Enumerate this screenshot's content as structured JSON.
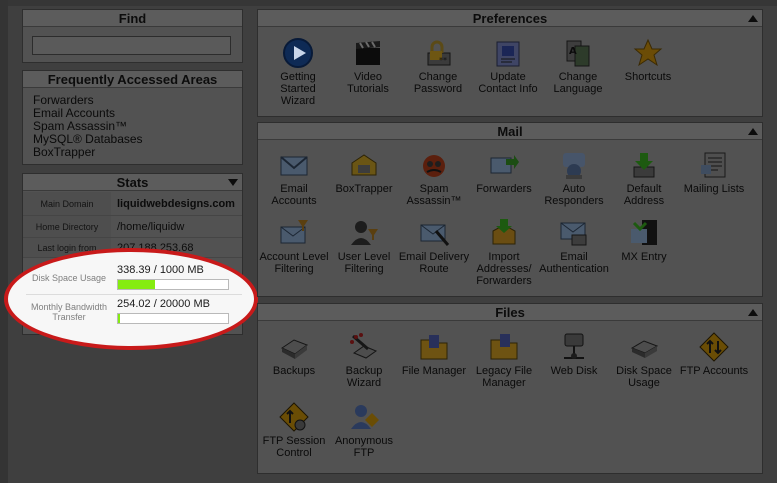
{
  "find": {
    "title": "Find",
    "input_value": ""
  },
  "faa": {
    "title": "Frequently Accessed Areas",
    "links": [
      "Forwarders",
      "Email Accounts",
      "Spam Assassin™",
      "MySQL® Databases",
      "BoxTrapper"
    ]
  },
  "stats": {
    "title": "Stats",
    "rows": [
      {
        "label": "Main Domain",
        "value": "liquidwebdesigns.com"
      },
      {
        "label": "Home Directory",
        "value": "/home/liquidw"
      },
      {
        "label": "Last login from",
        "value": "207.188.253.68"
      }
    ],
    "disk": {
      "label": "Disk Space Usage",
      "value": "338.39 / 1000 MB",
      "fraction": 0.34
    },
    "bandwidth": {
      "label": "Monthly Bandwidth Transfer",
      "value": "254.02 / 20000 MB",
      "fraction": 0.02
    }
  },
  "preferences": {
    "title": "Preferences",
    "items": [
      {
        "icon": "play-icon",
        "label": "Getting Started Wizard"
      },
      {
        "icon": "clapperboard-icon",
        "label": "Video Tutorials"
      },
      {
        "icon": "lock-password-icon",
        "label": "Change Password"
      },
      {
        "icon": "contact-card-icon",
        "label": "Update Contact Info"
      },
      {
        "icon": "language-icon",
        "label": "Change Language"
      },
      {
        "icon": "star-icon",
        "label": "Shortcuts"
      }
    ]
  },
  "mail": {
    "title": "Mail",
    "items": [
      {
        "icon": "envelope-icon",
        "label": "Email Accounts"
      },
      {
        "icon": "boxtrapper-icon",
        "label": "BoxTrapper"
      },
      {
        "icon": "spam-assassin-icon",
        "label": "Spam Assassin™"
      },
      {
        "icon": "forward-arrow-icon",
        "label": "Forwarders"
      },
      {
        "icon": "auto-responder-icon",
        "label": "Auto Responders"
      },
      {
        "icon": "download-arrow-icon",
        "label": "Default Address"
      },
      {
        "icon": "mailing-list-icon",
        "label": "Mailing Lists"
      },
      {
        "icon": "filter-envelope-icon",
        "label": "Account Level Filtering"
      },
      {
        "icon": "user-filter-icon",
        "label": "User Level Filtering"
      },
      {
        "icon": "delivery-route-icon",
        "label": "Email Delivery Route"
      },
      {
        "icon": "import-box-icon",
        "label": "Import Addresses/ Forwarders"
      },
      {
        "icon": "authentication-icon",
        "label": "Email Authentication"
      },
      {
        "icon": "mx-entry-icon",
        "label": "MX Entry"
      }
    ]
  },
  "files": {
    "title": "Files",
    "items": [
      {
        "icon": "hard-drive-icon",
        "label": "Backups"
      },
      {
        "icon": "backup-wand-icon",
        "label": "Backup Wizard"
      },
      {
        "icon": "folder-icon",
        "label": "File Manager"
      },
      {
        "icon": "legacy-folder-icon",
        "label": "Legacy File Manager"
      },
      {
        "icon": "network-disk-icon",
        "label": "Web Disk"
      },
      {
        "icon": "disk-usage-icon",
        "label": "Disk Space Usage"
      },
      {
        "icon": "ftp-sign-icon",
        "label": "FTP Accounts"
      },
      {
        "icon": "ftp-session-icon",
        "label": "FTP Session Control"
      },
      {
        "icon": "anonymous-ftp-icon",
        "label": "Anonymous FTP"
      }
    ]
  }
}
